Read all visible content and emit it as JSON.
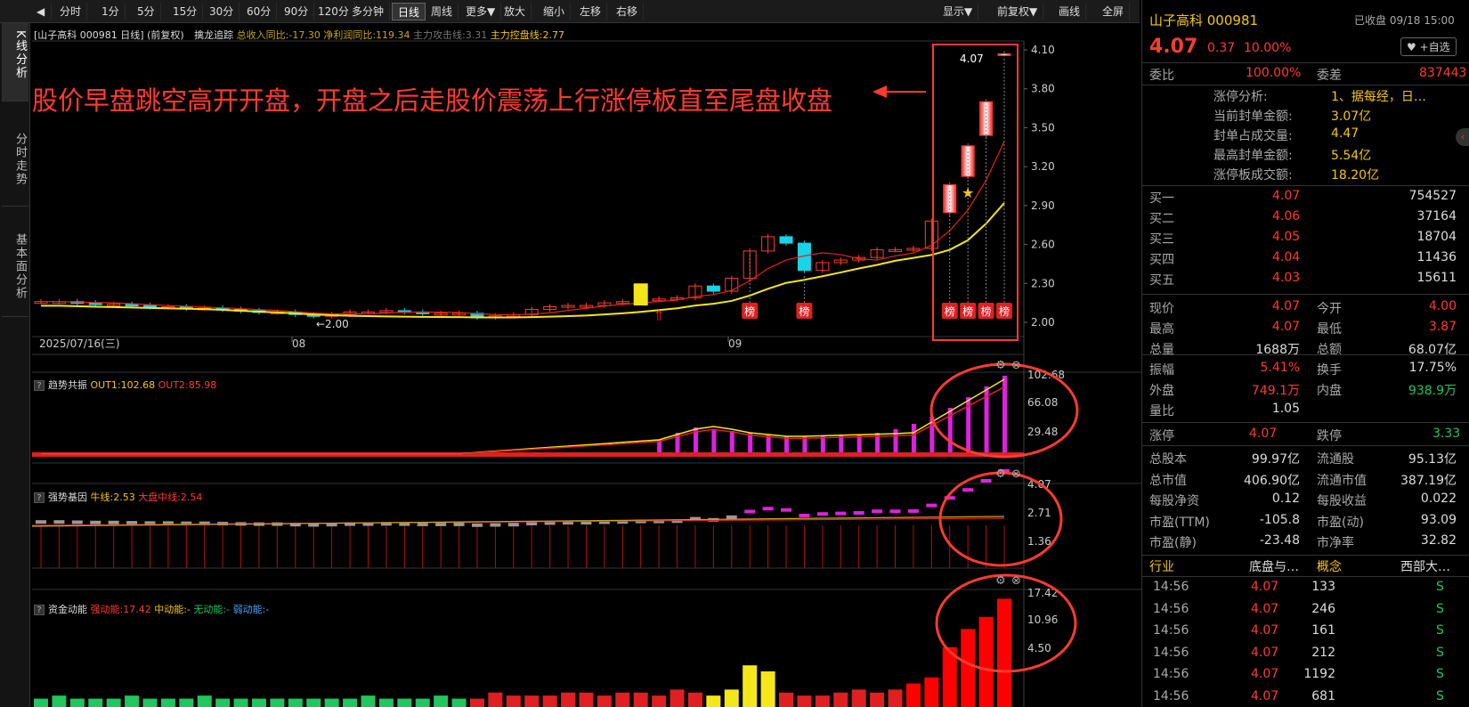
{
  "toolbar": {
    "buttons": [
      "分时",
      "1分",
      "5分",
      "15分",
      "30分",
      "60分",
      "90分",
      "120分",
      "多分钟",
      "日线",
      "周线",
      "更多▼",
      "放大",
      "缩小",
      "左移",
      "右移"
    ],
    "right_buttons": [
      "显示▼",
      "前复权▼",
      "画线",
      "全屏"
    ],
    "active": "日线"
  },
  "side_tabs": [
    "K线分析",
    "分时走势",
    "基本面分析"
  ],
  "main_header": {
    "stock": "[山子高科 000981 日线]",
    "adjust": "(前复权)",
    "indicator": "擒龙追踪",
    "revenue": "总收入同比:-17.30",
    "profit": "净利润同比:119.34",
    "attack": "主力攻击线:3.31",
    "control": "主力控盘线:2.77"
  },
  "annotation": "股价早盘跳空高开开盘，开盘之后走股价震荡上行涨停板直至尾盘收盘",
  "price_axis": [
    "4.10",
    "3.80",
    "3.50",
    "3.20",
    "2.90",
    "2.60",
    "2.30",
    "2.00"
  ],
  "date_labels": {
    "start": "2025/07/16(三)",
    "m1": "08",
    "m2": "09"
  },
  "low_marker": "2.00",
  "high_marker": "4.07",
  "bang_label": "榜",
  "panel1": {
    "name": "趋势共振",
    "out1": "OUT1:102.68",
    "out2": "OUT2:85.98",
    "axis": [
      "102.68",
      "66.08",
      "29.48"
    ]
  },
  "panel2": {
    "name": "强势基因",
    "niu": "牛线:2.53",
    "dapan": "大盘中线:2.54",
    "axis": [
      "4.07",
      "2.71",
      "1.36"
    ]
  },
  "panel3": {
    "name": "资金动能",
    "strong": "强动能:17.42",
    "mid": "中动能:-",
    "none": "无动能:-",
    "weak": "弱动能:-",
    "axis": [
      "17.42",
      "10.96",
      "4.50"
    ]
  },
  "quote": {
    "title": "山子高科 000981",
    "status": "已收盘 09/18 15:00",
    "price": "4.07",
    "change": "0.37",
    "pct": "10.00%",
    "fav": "+自选",
    "weibi_label": "委比",
    "weibi": "100.00%",
    "weicha_label": "委差",
    "weicha": "837443",
    "limit_info": [
      {
        "k": "涨停分析:",
        "v": "1、据每经，日…"
      },
      {
        "k": "当前封单金额:",
        "v": "3.07亿"
      },
      {
        "k": "封单占成交量:",
        "v": "4.47"
      },
      {
        "k": "最高封单金额:",
        "v": "5.54亿"
      },
      {
        "k": "涨停板成交额:",
        "v": "18.20亿"
      }
    ],
    "bids": [
      {
        "name": "买一",
        "price": "4.07",
        "vol": "754527"
      },
      {
        "name": "买二",
        "price": "4.06",
        "vol": "37164"
      },
      {
        "name": "买三",
        "price": "4.05",
        "vol": "18704"
      },
      {
        "name": "买四",
        "price": "4.04",
        "vol": "11436"
      },
      {
        "name": "买五",
        "price": "4.03",
        "vol": "15611"
      }
    ],
    "stats1": [
      [
        "现价",
        "4.07",
        "今开",
        "4.00"
      ],
      [
        "最高",
        "4.07",
        "最低",
        "3.87"
      ],
      [
        "总量",
        "1688万",
        "总额",
        "68.07亿"
      ]
    ],
    "stats2": [
      [
        "振幅",
        "5.41%",
        "换手",
        "17.75%"
      ],
      [
        "外盘",
        "749.1万",
        "内盘",
        "938.9万"
      ],
      [
        "量比",
        "1.05",
        "",
        ""
      ]
    ],
    "limits": [
      "涨停",
      "4.07",
      "跌停",
      "3.33"
    ],
    "stats3": [
      [
        "总股本",
        "99.97亿",
        "流通股",
        "95.13亿"
      ],
      [
        "总市值",
        "406.90亿",
        "流通市值",
        "387.19亿"
      ],
      [
        "每股净资",
        "0.12",
        "每股收益",
        "0.022"
      ],
      [
        "市盈(TTM)",
        "-105.8",
        "市盈(动)",
        "93.09"
      ],
      [
        "市盈(静)",
        "-23.48",
        "市净率",
        "32.82"
      ]
    ],
    "industry": [
      "行业",
      "底盘与…",
      "概念",
      "西部大…"
    ],
    "ticks": [
      [
        "14:56",
        "4.07",
        "133",
        "S"
      ],
      [
        "14:56",
        "4.07",
        "246",
        "S"
      ],
      [
        "14:56",
        "4.07",
        "161",
        "S"
      ],
      [
        "14:56",
        "4.07",
        "212",
        "S"
      ],
      [
        "14:56",
        "4.07",
        "1192",
        "S"
      ],
      [
        "14:56",
        "4.07",
        "681",
        "S"
      ]
    ]
  },
  "chart_data": {
    "type": "candlestick",
    "title": "山子高科 000981 日线",
    "closes": [
      2.16,
      2.16,
      2.15,
      2.14,
      2.14,
      2.13,
      2.12,
      2.12,
      2.11,
      2.11,
      2.1,
      2.09,
      2.08,
      2.08,
      2.06,
      2.05,
      2.06,
      2.08,
      2.08,
      2.09,
      2.08,
      2.07,
      2.07,
      2.07,
      2.04,
      2.05,
      2.06,
      2.1,
      2.12,
      2.13,
      2.13,
      2.15,
      2.16,
      2.18,
      2.18,
      2.19,
      2.28,
      2.24,
      2.34,
      2.55,
      2.66,
      2.61,
      2.4,
      2.46,
      2.48,
      2.5,
      2.56,
      2.56,
      2.57,
      2.78,
      3.06,
      3.36,
      3.7,
      4.07
    ],
    "ylim": [
      2.0,
      4.15
    ]
  }
}
